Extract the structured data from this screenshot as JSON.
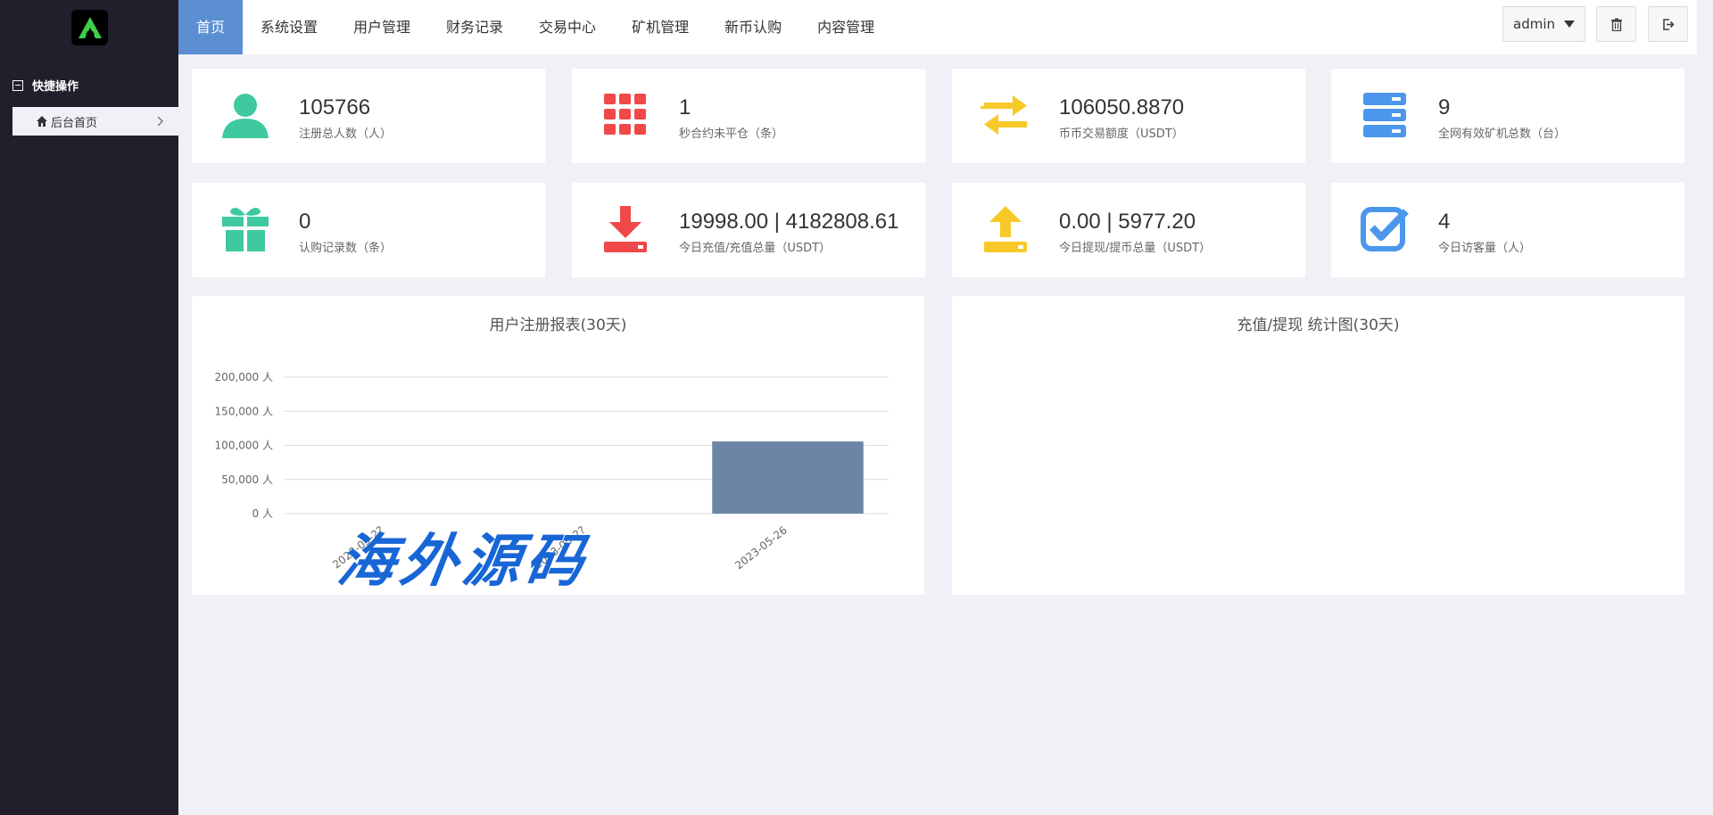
{
  "nav": {
    "items": [
      "首页",
      "系统设置",
      "用户管理",
      "财务记录",
      "交易中心",
      "矿机管理",
      "新币认购",
      "内容管理"
    ],
    "user": "admin"
  },
  "sidebar": {
    "section_title": "快捷操作",
    "items": [
      {
        "label": "后台首页"
      }
    ]
  },
  "stats": [
    {
      "value": "105766",
      "label": "注册总人数（人）",
      "icon": "user-icon",
      "color": "#3ec9a0"
    },
    {
      "value": "1",
      "label": "秒合约未平仓（条）",
      "icon": "grid-icon",
      "color": "#f04848"
    },
    {
      "value": "106050.8870",
      "label": "币币交易额度（USDT）",
      "icon": "exchange-icon",
      "color": "#f6c928"
    },
    {
      "value": "9",
      "label": "全网有效矿机总数（台）",
      "icon": "server-icon",
      "color": "#4b97ec"
    },
    {
      "value": "0",
      "label": "认购记录数（条）",
      "icon": "gift-icon",
      "color": "#3ec9a0"
    },
    {
      "value": "19998.00 | 4182808.61",
      "label": "今日充值/充值总量（USDT）",
      "icon": "download-icon",
      "color": "#f04848"
    },
    {
      "value": "0.00 | 5977.20",
      "label": "今日提现/提币总量（USDT）",
      "icon": "upload-icon",
      "color": "#f6c928"
    },
    {
      "value": "4",
      "label": "今日访客量（人）",
      "icon": "check-icon",
      "color": "#4b97ec"
    }
  ],
  "charts": {
    "register_title": "用户注册报表(30天)",
    "finance_title": "充值/提现 统计图(30天)"
  },
  "chart_data": {
    "type": "bar",
    "title": "用户注册报表(30天)",
    "categories": [
      "2023-05-2?",
      "2023-05-2?",
      "2023-05-26"
    ],
    "values": [
      0,
      0,
      105766
    ],
    "ylim": [
      0,
      200000
    ],
    "yticks": [
      0,
      50000,
      100000,
      150000,
      200000
    ],
    "ytick_labels": [
      "0 人",
      "50,000 人",
      "100,000 人",
      "150,000 人",
      "200,000 人"
    ],
    "bar_color": "#6b85a4",
    "grid": true
  },
  "watermark": "海外源码"
}
